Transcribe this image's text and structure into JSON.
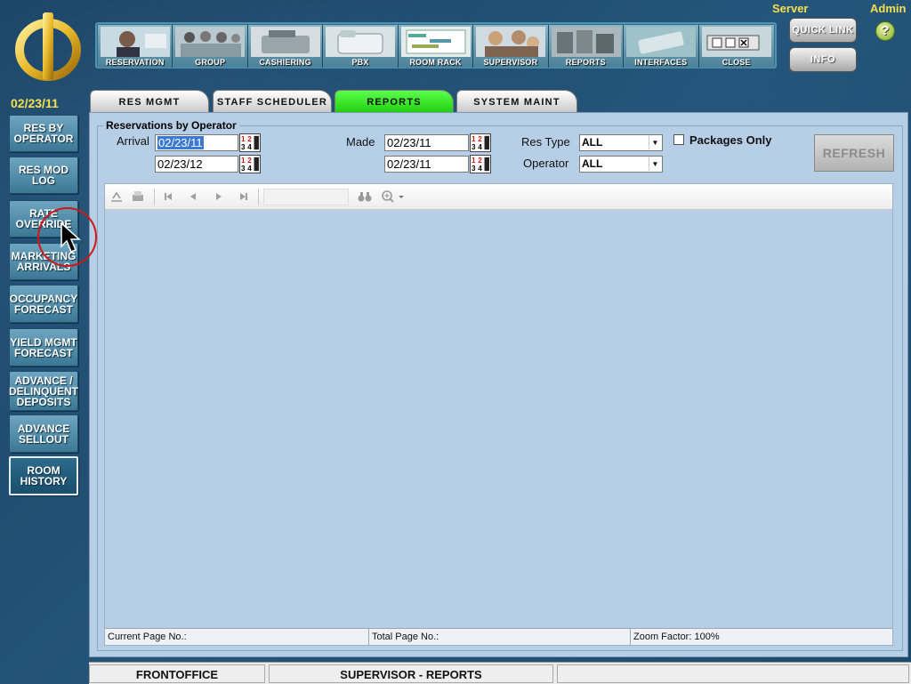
{
  "header": {
    "server_label": "Server",
    "admin_label": "Admin",
    "quick_link_label": "QUICK LINK",
    "info_label": "INFO",
    "help_symbol": "?"
  },
  "toolbar": {
    "items": [
      {
        "label": "RESERVATION",
        "icon": "headset-agent-icon"
      },
      {
        "label": "GROUP",
        "icon": "group-people-icon"
      },
      {
        "label": "CASHIERING",
        "icon": "cash-register-icon"
      },
      {
        "label": "PBX",
        "icon": "phone-icon"
      },
      {
        "label": "ROOM RACK",
        "icon": "room-grid-icon"
      },
      {
        "label": "SUPERVISOR",
        "icon": "supervisor-people-icon"
      },
      {
        "label": "REPORTS",
        "icon": "reports-icon"
      },
      {
        "label": "INTERFACES",
        "icon": "interfaces-icon"
      },
      {
        "label": "CLOSE",
        "icon": "window-close-icon"
      }
    ]
  },
  "current_date": "02/23/11",
  "tabs": [
    {
      "label": "RES MGMT"
    },
    {
      "label": "STAFF SCHEDULER"
    },
    {
      "label": "REPORTS",
      "active": true
    },
    {
      "label": "SYSTEM MAINT"
    }
  ],
  "sidebar": {
    "items": [
      {
        "label": "RES BY\nOPERATOR",
        "selected": false
      },
      {
        "label": "RES MOD\nLOG",
        "selected": false
      },
      {
        "label": "RATE\nOVERRIDE",
        "selected": false
      },
      {
        "label": "MARKETING\nARRIVALS",
        "selected": false
      },
      {
        "label": "OCCUPANCY\nFORECAST",
        "selected": false
      },
      {
        "label": "YIELD MGMT\nFORECAST",
        "selected": false
      },
      {
        "label": "ADVANCE /\nDELINQUENT\nDEPOSITS",
        "selected": false
      },
      {
        "label": "ADVANCE\nSELLOUT",
        "selected": false
      },
      {
        "label": "ROOM\nHISTORY",
        "selected": true
      }
    ]
  },
  "form": {
    "title": "Reservations by Operator",
    "arrival_label": "Arrival",
    "arrival_from": "02/23/11",
    "arrival_to": "02/23/12",
    "made_label": "Made",
    "made_from": "02/23/11",
    "made_to": "02/23/11",
    "res_type_label": "Res Type",
    "res_type_value": "ALL",
    "operator_label": "Operator",
    "operator_value": "ALL",
    "packages_only_label": "Packages Only",
    "refresh_label": "REFRESH"
  },
  "viewer": {
    "current_page_label": "Current Page No.:",
    "total_page_label": "Total Page No.:",
    "zoom_label": "Zoom Factor: 100%"
  },
  "statusbar": {
    "module": "FRONTOFFICE",
    "screen": "SUPERVISOR - REPORTS",
    "extra": ""
  },
  "colors": {
    "background": "#1d4a6e",
    "accent_yellow": "#f4e04d",
    "active_tab": "#21d10f",
    "panel": "#b7cfe6"
  }
}
